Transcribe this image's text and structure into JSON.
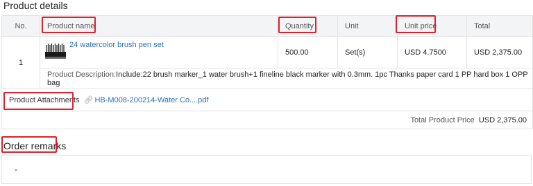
{
  "details": {
    "title": "Product details",
    "headers": {
      "no": "No.",
      "name": "Product name",
      "qty": "Quantity",
      "unit": "Unit",
      "price": "Unit price",
      "total": "Total"
    },
    "item": {
      "no": "1",
      "name": "24 watercolor brush pen set",
      "qty": "500.00",
      "unit": "Set(s)",
      "price": "USD 4.7500",
      "total": "USD 2,375.00",
      "description_label": "Product Description:",
      "description": "Include:22 brush marker_1 water brush+1 fineline black marker with 0.3mm. 1pc Thanks paper card 1 PP hard box 1 OPP bag"
    },
    "attachments_label": "Product Attachments",
    "attachment_file": "HB-M008-200214-Water Co....pdf",
    "total_label": "Total Product Price",
    "total_value": "USD 2,375.00"
  },
  "remarks": {
    "title": "Order remarks",
    "value": "-"
  },
  "colors": {
    "highlight": "#e0202a",
    "link": "#2b6fc2",
    "header_bg": "#f3f4f6"
  }
}
